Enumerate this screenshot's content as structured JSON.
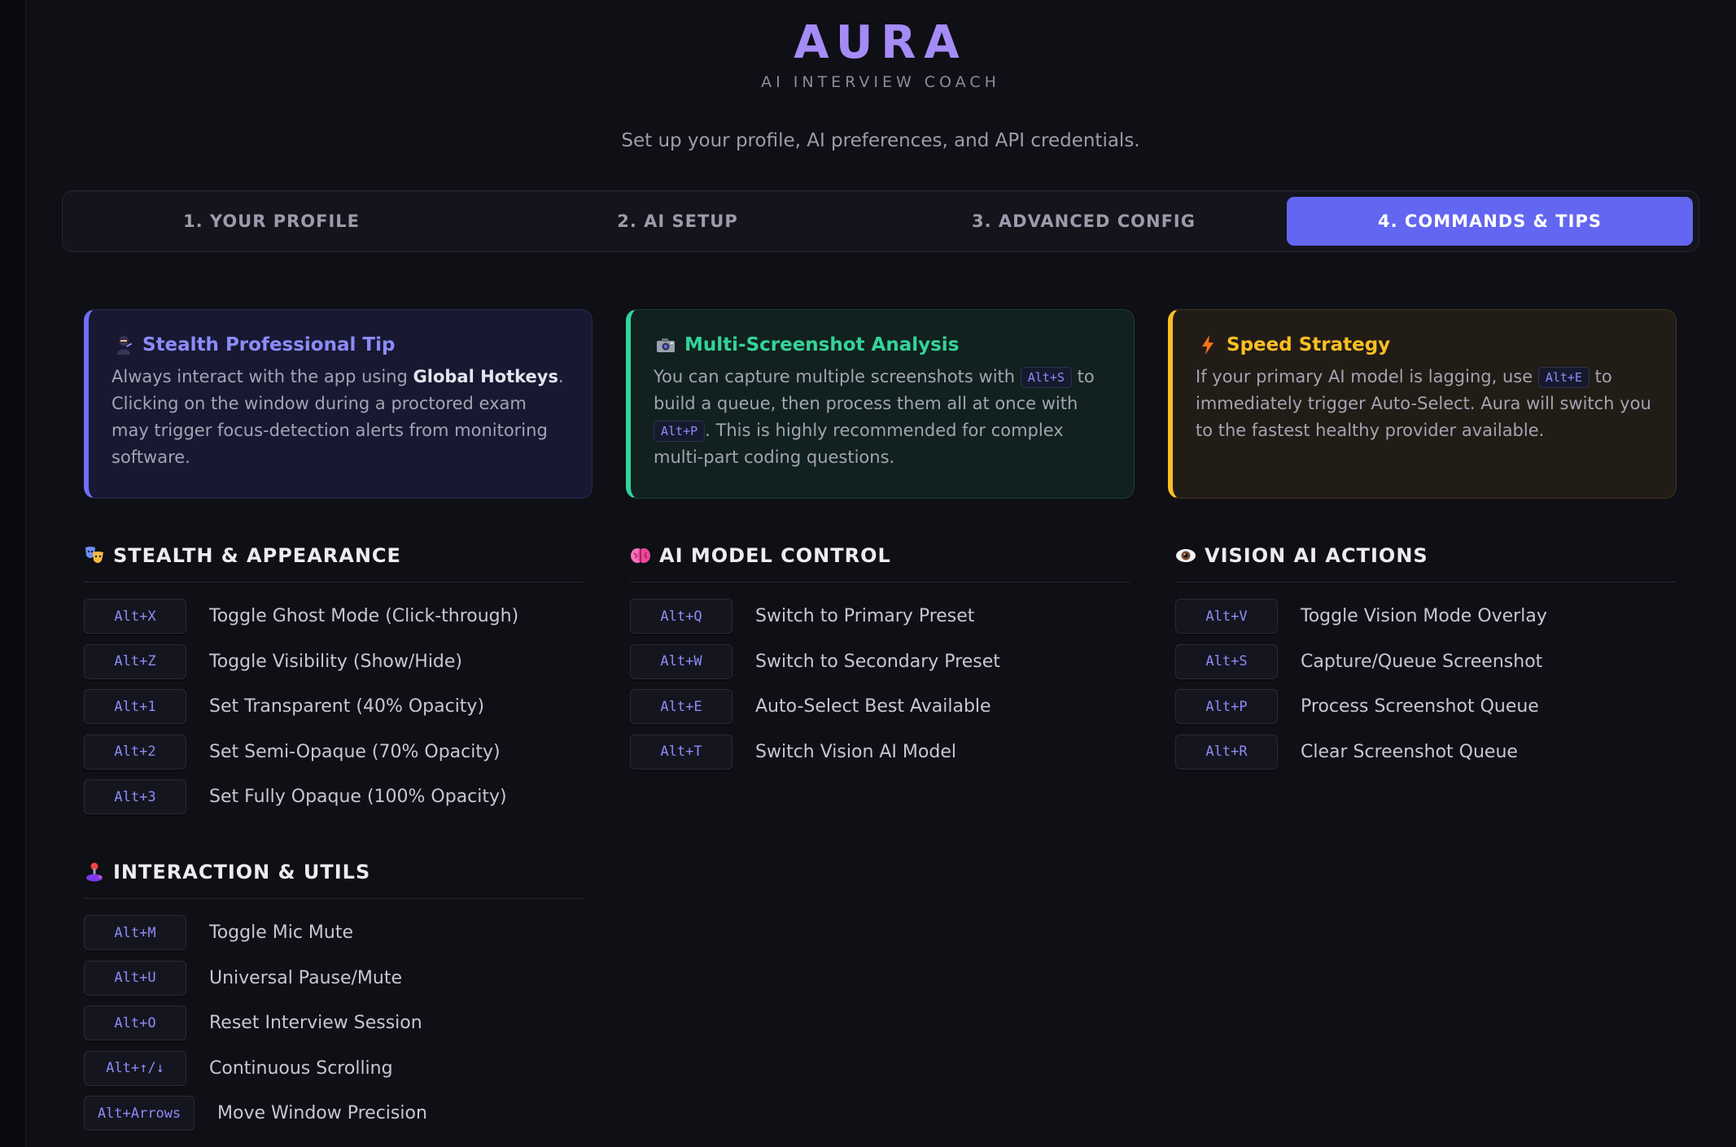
{
  "header": {
    "title": "AURA",
    "subtitle": "AI INTERVIEW COACH",
    "intro": "Set up your profile, AI preferences, and API credentials."
  },
  "tabs": [
    {
      "label": "1. YOUR PROFILE",
      "active": false
    },
    {
      "label": "2. AI SETUP",
      "active": false
    },
    {
      "label": "3. ADVANCED CONFIG",
      "active": false
    },
    {
      "label": "4. COMMANDS & TIPS",
      "active": true
    }
  ],
  "tips": {
    "stealth": {
      "icon": "ninja-icon",
      "title": "Stealth Professional Tip",
      "text_before": "Always interact with the app using ",
      "bold": "Global Hotkeys",
      "text_after": ". Clicking on the window during a proctored exam may trigger focus-detection alerts from monitoring software."
    },
    "multi": {
      "icon": "camera-icon",
      "title": "Multi-Screenshot Analysis",
      "text_1": "You can capture multiple screenshots with ",
      "key_1": "Alt+S",
      "text_2": " to build a queue, then process them all at once with ",
      "key_2": "Alt+P",
      "text_3": ". This is highly recommended for complex multi-part coding questions."
    },
    "speed": {
      "icon": "lightning-icon",
      "title": "Speed Strategy",
      "text_1": "If your primary AI model is lagging, use ",
      "key_1": "Alt+E",
      "text_2": " to immediately trigger Auto-Select. Aura will switch you to the fastest healthy provider available."
    }
  },
  "sections": {
    "stealth": {
      "icon": "theater-masks-icon",
      "title": "STEALTH & APPEARANCE",
      "rows": [
        {
          "key": "Alt+X",
          "label": "Toggle Ghost Mode (Click-through)"
        },
        {
          "key": "Alt+Z",
          "label": "Toggle Visibility (Show/Hide)"
        },
        {
          "key": "Alt+1",
          "label": "Set Transparent (40% Opacity)"
        },
        {
          "key": "Alt+2",
          "label": "Set Semi-Opaque (70% Opacity)"
        },
        {
          "key": "Alt+3",
          "label": "Set Fully Opaque (100% Opacity)"
        }
      ]
    },
    "ai_model": {
      "icon": "brain-icon",
      "title": "AI MODEL CONTROL",
      "rows": [
        {
          "key": "Alt+Q",
          "label": "Switch to Primary Preset"
        },
        {
          "key": "Alt+W",
          "label": "Switch to Secondary Preset"
        },
        {
          "key": "Alt+E",
          "label": "Auto-Select Best Available"
        },
        {
          "key": "Alt+T",
          "label": "Switch Vision AI Model"
        }
      ]
    },
    "vision": {
      "icon": "eye-icon",
      "title": "VISION AI ACTIONS",
      "rows": [
        {
          "key": "Alt+V",
          "label": "Toggle Vision Mode Overlay"
        },
        {
          "key": "Alt+S",
          "label": "Capture/Queue Screenshot"
        },
        {
          "key": "Alt+P",
          "label": "Process Screenshot Queue"
        },
        {
          "key": "Alt+R",
          "label": "Clear Screenshot Queue"
        }
      ]
    },
    "interaction": {
      "icon": "joystick-icon",
      "title": "INTERACTION & UTILS",
      "rows": [
        {
          "key": "Alt+M",
          "label": "Toggle Mic Mute"
        },
        {
          "key": "Alt+U",
          "label": "Universal Pause/Mute"
        },
        {
          "key": "Alt+O",
          "label": "Reset Interview Session"
        },
        {
          "key": "Alt+↑/↓",
          "label": "Continuous Scrolling"
        },
        {
          "key": "Alt+Arrows",
          "label": "Move Window Precision"
        }
      ]
    }
  },
  "colors": {
    "accent": "#6366f1",
    "brand": "#a48bf6",
    "tip_purple": "#6d6ff6",
    "tip_green": "#34d399",
    "tip_amber": "#fbbf24"
  }
}
